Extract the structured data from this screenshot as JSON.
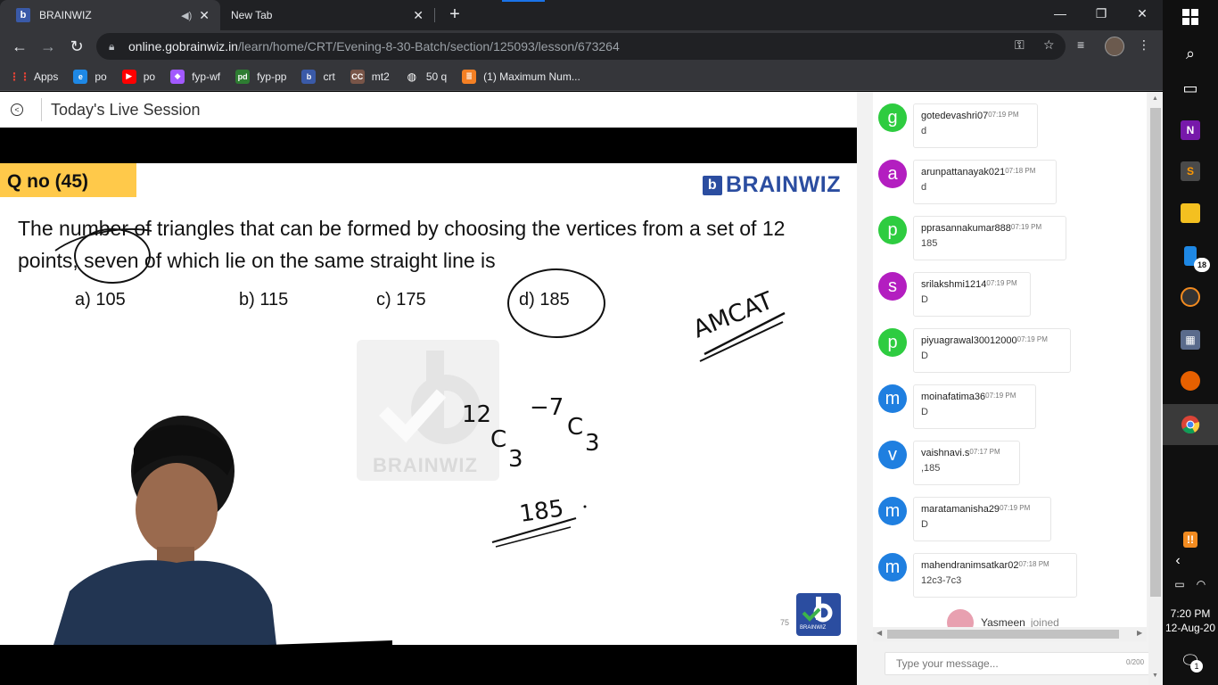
{
  "browser": {
    "tabs": [
      {
        "label": "BRAINWIZ",
        "favicon": "b"
      },
      {
        "label": "New Tab"
      }
    ],
    "url_host": "online.gobrainwiz.in",
    "url_path": "/learn/home/CRT/Evening-8-30-Batch/section/125093/lesson/673264",
    "bookmarks": [
      {
        "label": "Apps",
        "icon": "apps-grid-icon",
        "color": "#e8eaed"
      },
      {
        "label": "po",
        "icon": "e",
        "color": "#1e88e5"
      },
      {
        "label": "po",
        "icon": "▶",
        "color": "#ff0000"
      },
      {
        "label": "fyp-wf",
        "icon": "figma",
        "color": "#a259ff"
      },
      {
        "label": "fyp-pp",
        "icon": "pd",
        "color": "#2e7d32"
      },
      {
        "label": "crt",
        "icon": "b",
        "color": "#3a5aa8"
      },
      {
        "label": "mt2",
        "icon": "CC",
        "color": "#795548"
      },
      {
        "label": "50 q",
        "icon": "globe",
        "color": "#e8eaed"
      },
      {
        "label": "(1) Maximum Num...",
        "icon": "stack",
        "color": "#f48024"
      }
    ]
  },
  "session": {
    "title": "Today's Live Session"
  },
  "slide": {
    "qno": "Q no (45)",
    "brand": "BRAINWIZ",
    "question": "The number of triangles that can be formed by choosing the vertices from a set of 12 points, seven of which lie on the same straight line is",
    "options": [
      "a) 105",
      "b) 115",
      "c) 175",
      "d) 185"
    ],
    "watermark": "BRAINWIZ",
    "page_number": "75",
    "logo_text": "BRAINWIZ",
    "ink": {
      "amcat": "AMCAT",
      "twelve": "12",
      "c3a": "C",
      "three_a": "3",
      "minus_seven": "−7",
      "c3b": "C",
      "three_b": "3",
      "result": "185"
    }
  },
  "chat": {
    "messages": [
      {
        "initial": "g",
        "color": "#2ecc40",
        "user": "gotedevashri07",
        "time": "07:19 PM",
        "text": "d",
        "width": 140
      },
      {
        "initial": "a",
        "color": "#b31ec0",
        "user": "arunpattanayak021",
        "time": "07:18 PM",
        "text": "d",
        "width": 161
      },
      {
        "initial": "p",
        "color": "#2ecc40",
        "user": "pprasannakumar888",
        "time": "07:19 PM",
        "text": "185",
        "width": 172
      },
      {
        "initial": "s",
        "color": "#b31ec0",
        "user": "srilakshmi1214",
        "time": "07:19 PM",
        "text": "D",
        "width": 132
      },
      {
        "initial": "p",
        "color": "#2ecc40",
        "user": "piyuagrawal30012000",
        "time": "07:19 PM",
        "text": "D",
        "width": 177
      },
      {
        "initial": "m",
        "color": "#1f7fe0",
        "user": "moinafatima36",
        "time": "07:19 PM",
        "text": "D",
        "width": 138
      },
      {
        "initial": "v",
        "color": "#1f7fe0",
        "user": "vaishnavi.s",
        "time": "07:17 PM",
        "text": ",185",
        "width": 120
      },
      {
        "initial": "m",
        "color": "#1f7fe0",
        "user": "maratamanisha29",
        "time": "07:19 PM",
        "text": "D",
        "width": 155
      },
      {
        "initial": "m",
        "color": "#1f7fe0",
        "user": "mahendranimsatkar02",
        "time": "07:18 PM",
        "text": "12c3-7c3",
        "width": 184
      }
    ],
    "joined_user": "Yasmeen",
    "joined_text": "joined",
    "input_placeholder": "Type your message...",
    "char_count": "0/200"
  },
  "taskbar": {
    "time": "7:20 PM",
    "date": "12-Aug-20",
    "badge": "18",
    "notification_count": "1"
  }
}
